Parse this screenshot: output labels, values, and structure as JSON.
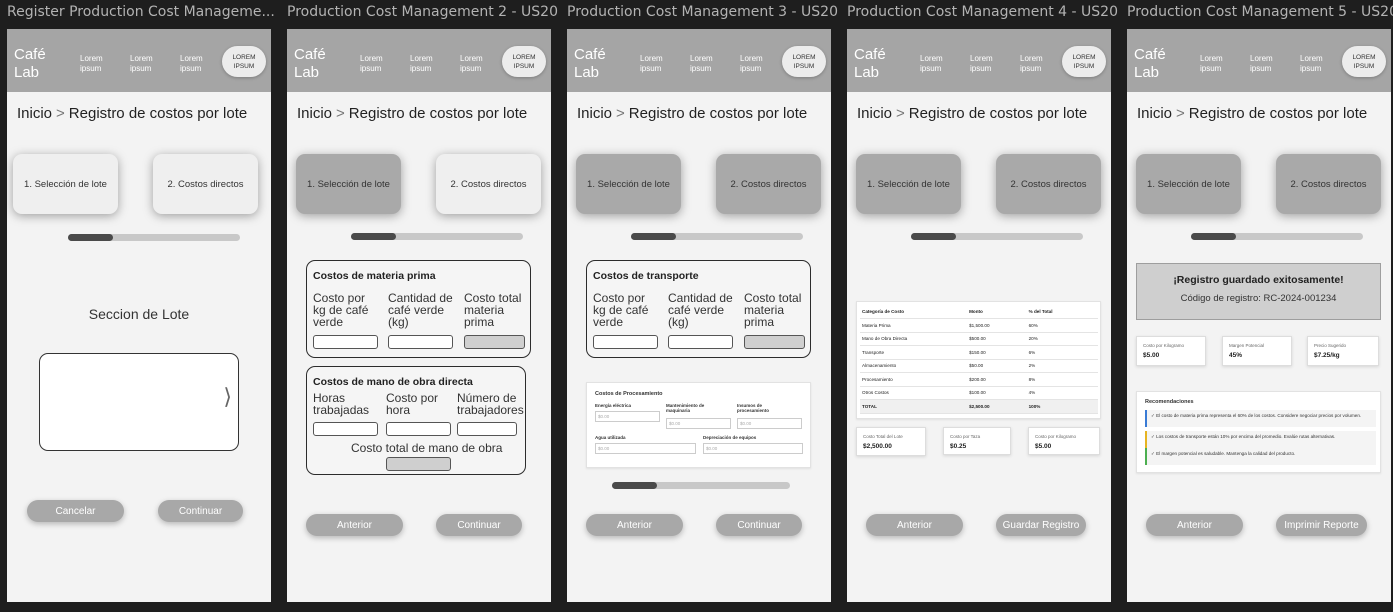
{
  "frames": [
    {
      "title": "Register Production Cost Manageme..."
    },
    {
      "title": "Production Cost Management 2 - US20"
    },
    {
      "title": "Production Cost Management 3 - US20"
    },
    {
      "title": "Production Cost Management 4 - US20"
    },
    {
      "title": "Production Cost Management 5 - US20"
    }
  ],
  "header": {
    "logo": "Café Lab",
    "nav": [
      "Lorem ipsum",
      "Lorem ipsum",
      "Lorem ipsum"
    ],
    "button": "LOREM IPSUM"
  },
  "breadcrumb": {
    "home": "Inicio",
    "sep": ">",
    "current": "Registro de costos por lote"
  },
  "steps": [
    "1. Selección de lote",
    "2. Costos directos"
  ],
  "f1": {
    "section_title": "Seccion de Lote",
    "chevron": "⟩",
    "cancel": "Cancelar",
    "continue": "Continuar"
  },
  "f2": {
    "mp_title": "Costos de materia prima",
    "mp_cols": [
      "Costo por kg de café verde",
      "Cantidad de café verde (kg)",
      "Costo total materia prima"
    ],
    "mo_title": "Costos de mano de obra directa",
    "mo_cols": [
      "Horas trabajadas",
      "Costo por hora",
      "Número de trabajadores"
    ],
    "mo_total": "Costo total de mano de obra",
    "prev": "Anterior",
    "continue": "Continuar"
  },
  "f3": {
    "tr_title": "Costos de transporte",
    "tr_cols": [
      "Costo por kg de café verde",
      "Cantidad de café verde (kg)",
      "Costo total materia prima"
    ],
    "proc_title": "Costos de Procesamiento",
    "proc_fields": [
      {
        "label": "Energía eléctrica",
        "value": "$0.00"
      },
      {
        "label": "Mantenimiento de maquinaria",
        "value": "$0.00"
      },
      {
        "label": "Insumos de procesamiento",
        "value": "$0.00"
      },
      {
        "label": "Agua utilizada",
        "value": "$0.00"
      },
      {
        "label": "Depreciación de equipos",
        "value": "$0.00"
      }
    ],
    "prev": "Anterior",
    "continue": "Continuar"
  },
  "f4": {
    "table": {
      "headers": [
        "Categoría de Costo",
        "Monto",
        "% del Total"
      ],
      "rows": [
        [
          "Materia Prima",
          "$1,500.00",
          "60%"
        ],
        [
          "Mano de Obra Directa",
          "$500.00",
          "20%"
        ],
        [
          "Transporte",
          "$150.00",
          "6%"
        ],
        [
          "Almacenamiento",
          "$50.00",
          "2%"
        ],
        [
          "Procesamiento",
          "$200.00",
          "8%"
        ],
        [
          "Otros Costos",
          "$100.00",
          "4%"
        ],
        [
          "TOTAL",
          "$2,500.00",
          "100%"
        ]
      ]
    },
    "summary": [
      {
        "label": "Costo Total del Lote",
        "value": "$2,500.00"
      },
      {
        "label": "Costo por Taza",
        "value": "$0.25"
      },
      {
        "label": "Costo por Kilogramo",
        "value": "$5.00"
      }
    ],
    "prev": "Anterior",
    "save": "Guardar Registro"
  },
  "f5": {
    "success_title": "¡Registro guardado exitosamente!",
    "code_text": "Código de registro: RC-2024-001234",
    "metrics": [
      {
        "label": "Costo por Kilogramo",
        "value": "$5.00"
      },
      {
        "label": "Margen Potencial",
        "value": "45%"
      },
      {
        "label": "Precio Sugerido",
        "value": "$7.25/kg"
      }
    ],
    "rec_title": "Recomendaciones",
    "recs": [
      {
        "text": "✓ El costo de materia prima representa el 60% de los costos. Considere negociar precios por volumen.",
        "color": "#3a7bd5"
      },
      {
        "text": "✓ Los costos de transporte están 10% por encima del promedio. Evalúe rutas alternativas.",
        "color": "#e6b422"
      },
      {
        "text": "✓ El margen potencial es saludable. Mantenga la calidad del producto.",
        "color": "#4caf50"
      }
    ],
    "prev": "Anterior",
    "print": "Imprimir Reporte"
  }
}
